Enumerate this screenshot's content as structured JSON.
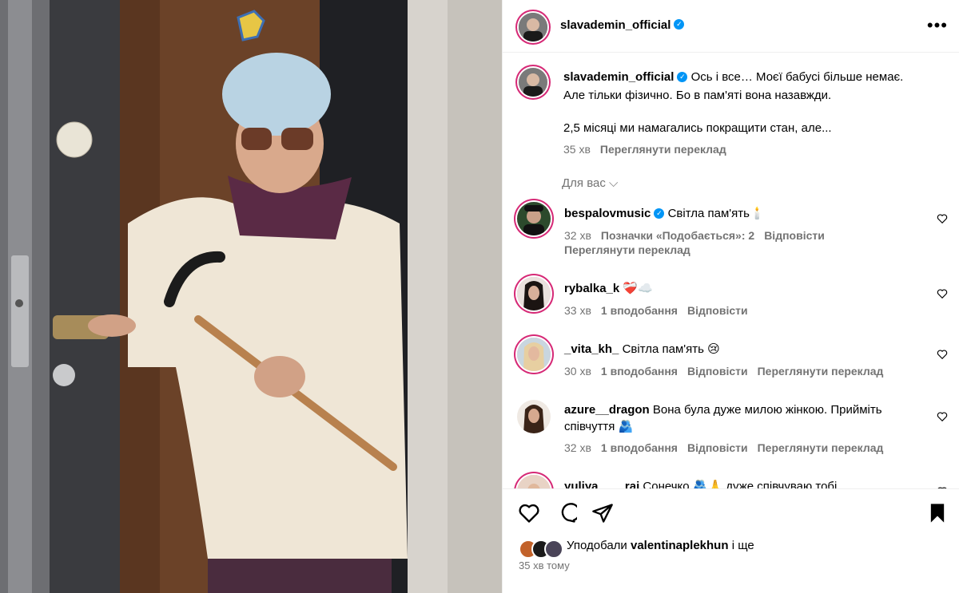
{
  "post": {
    "author": "slavademin_official",
    "caption_line1": "Ось і все… Моєї бабусі більше немає.",
    "caption_line2": "Але тільки фізично. Бо в пам'яті вона назавжди.",
    "caption_line3": "2,5 місяці ми намагались покращити стан, але...",
    "time": "35 хв",
    "translate": "Переглянути переклад"
  },
  "for_you_label": "Для вас",
  "comments": [
    {
      "user": "bespalovmusic",
      "text": "Світла пам'ять🕯️",
      "time": "32 хв",
      "likes": "Позначки «Подобається»: 2",
      "reply": "Відповісти",
      "translate": "Переглянути переклад"
    },
    {
      "user": "rybalka_k",
      "text": "❤️‍🩹☁️",
      "time": "33 хв",
      "likes": "1 вподобання",
      "reply": "Відповісти"
    },
    {
      "user": "_vita_kh_",
      "text": "Світла пам'ять 😢",
      "time": "30 хв",
      "likes": "1 вподобання",
      "reply": "Відповісти",
      "translate": "Переглянути переклад"
    },
    {
      "user": "azure__dragon",
      "text": "Вона була дуже милою жінкою. Прийміть співчуття 🫂",
      "time": "32 хв",
      "likes": "1 вподобання",
      "reply": "Відповісти",
      "translate": "Переглянути переклад"
    },
    {
      "user": "yuliya____rai",
      "text": "Сонечко 🫂🙏 дуже співчуваю тобі"
    }
  ],
  "footer": {
    "liked_prefix": "Уподобали",
    "liked_user": "valentinaplekhun",
    "liked_suffix": "і ще",
    "time": "35 хв тому"
  },
  "colors": {
    "accent": "#0095f6",
    "muted": "#737373",
    "border": "#efefef"
  }
}
